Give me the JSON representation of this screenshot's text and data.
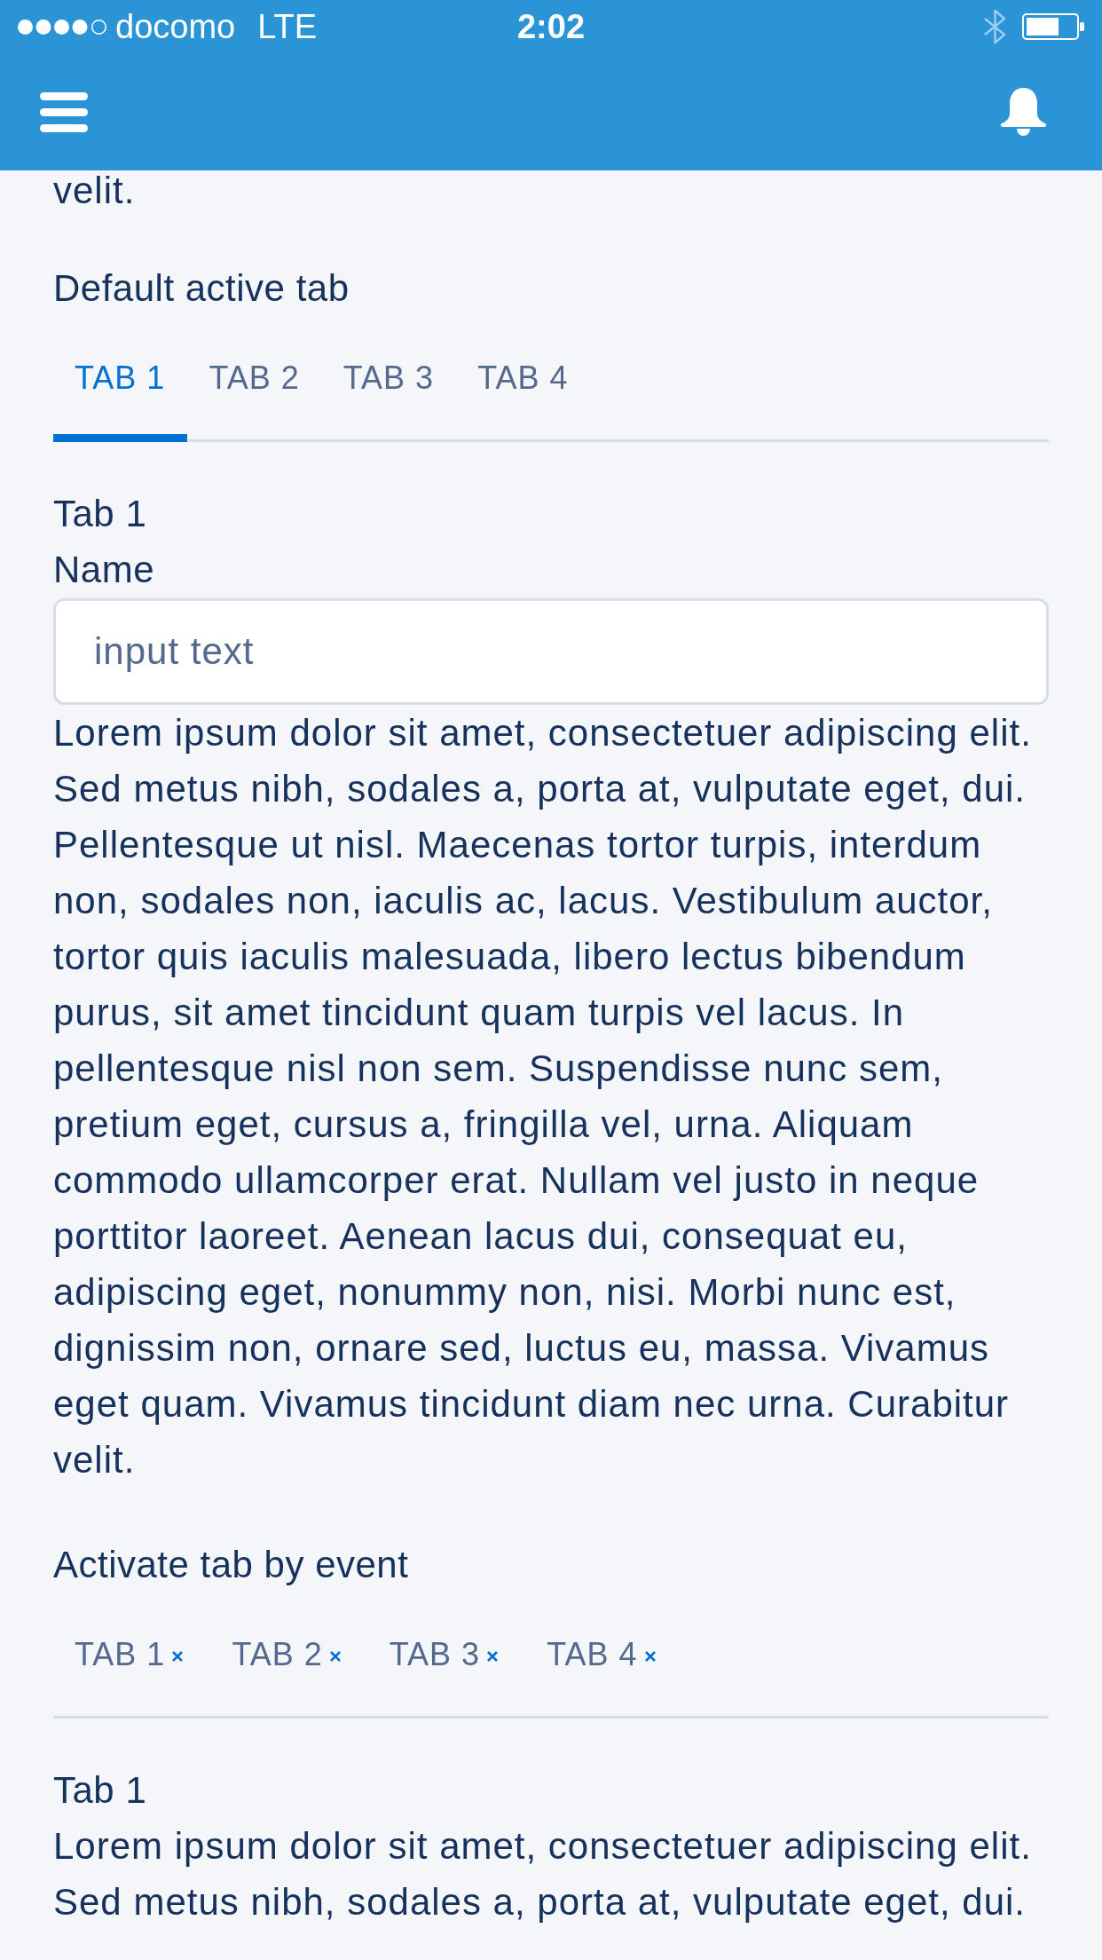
{
  "status_bar": {
    "carrier": "docomo",
    "network": "LTE",
    "time": "2:02"
  },
  "top_text": "velit.",
  "sections": [
    {
      "heading": "Default active tab",
      "closable_tabs": false,
      "tabs": [
        {
          "label": "TAB 1",
          "selected": true
        },
        {
          "label": "TAB 2",
          "selected": false
        },
        {
          "label": "TAB 3",
          "selected": false
        },
        {
          "label": "TAB 4",
          "selected": false
        }
      ],
      "panel": {
        "title": "Tab 1",
        "field": {
          "label": "Name",
          "placeholder": "input text"
        },
        "text": "Lorem ipsum dolor sit amet, consectetuer adipiscing elit. Sed metus nibh, sodales a, porta at, vulputate eget, dui. Pellentesque ut nisl. Maecenas tortor turpis, interdum non, sodales non, iaculis ac, lacus. Vestibulum auctor, tortor quis iaculis malesuada, libero lectus bibendum purus, sit amet tincidunt quam turpis vel lacus. In pellentesque nisl non sem. Suspendisse nunc sem, pretium eget, cursus a, fringilla vel, urna. Aliquam commodo ullamcorper erat. Nullam vel justo in neque porttitor laoreet. Aenean lacus dui, consequat eu, adipiscing eget, nonummy non, nisi. Morbi nunc est, dignissim non, ornare sed, luctus eu, massa. Vivamus eget quam. Vivamus tincidunt diam nec urna. Curabitur velit."
      }
    },
    {
      "heading": "Activate tab by event",
      "closable_tabs": true,
      "tabs": [
        {
          "label": "TAB 1",
          "selected": false
        },
        {
          "label": "TAB 2",
          "selected": false
        },
        {
          "label": "TAB 3",
          "selected": false
        },
        {
          "label": "TAB 4",
          "selected": false
        }
      ],
      "panel": {
        "title": "Tab 1",
        "text": "Lorem ipsum dolor sit amet, consectetuer adipiscing elit. Sed metus nibh, sodales a, porta at, vulputate eget, dui."
      }
    }
  ]
}
